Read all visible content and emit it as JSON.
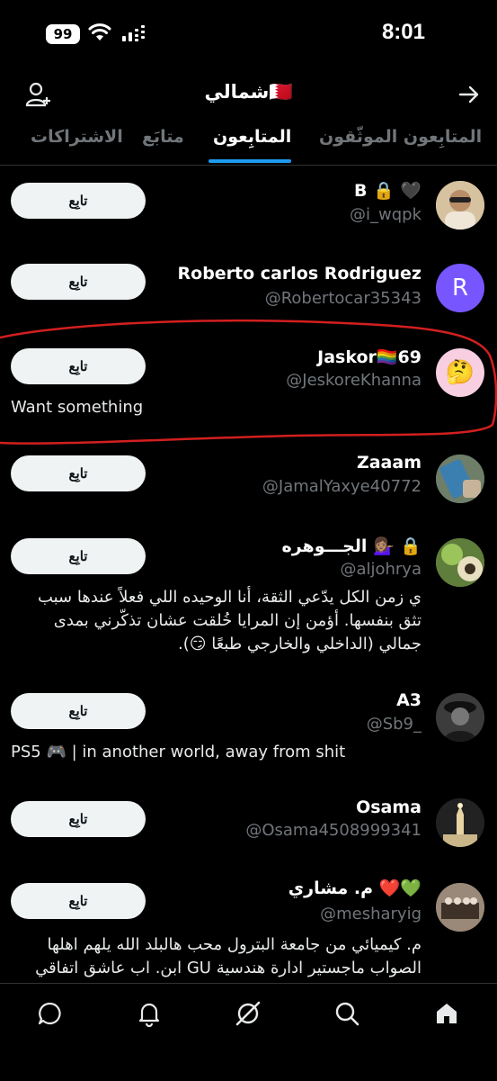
{
  "status": {
    "time": "8:01",
    "battery": "99"
  },
  "header": {
    "title": "شمالي🇧🇭"
  },
  "tabs": [
    "المتابِعون الموثّقون",
    "المتابِعون",
    "متابَع",
    "الاشتراكات"
  ],
  "follow_label": "تابِع",
  "users": [
    {
      "name": "B 🔒 🖤",
      "handle": "@i_wqpk",
      "bio": ""
    },
    {
      "name": "Roberto carlos Rodriguez",
      "handle": "@Robertocar35343",
      "avatar_letter": "R",
      "bio": ""
    },
    {
      "name": "Jaskor🏳️‍🌈69",
      "handle": "@JeskoreKhanna",
      "avatar_emoji": "🤔",
      "bio": "Want something"
    },
    {
      "name": "Zaaam",
      "handle": "@JamalYaxye40772",
      "bio": ""
    },
    {
      "name": "الجـــوهره 💁🏽‍♀️ 🔒",
      "handle": "@aljohrya",
      "bio": "ي زمن الكل يدّعي الثقة، أنا الوحيده اللي فعلاً عندها سبب تثق بنفسها. أؤمن إن المرايا خُلقت عشان تذكّرني بمدى جمالي (الداخلي والخارجي طبعًا 😏)."
    },
    {
      "name": "A3",
      "handle": "@Sb9_",
      "bio": "PS5 🎮 | in another world, away from shit"
    },
    {
      "name": "Osama",
      "handle": "@Osama4508999341",
      "bio": ""
    },
    {
      "name": "م. مشاري ❤️💚",
      "handle": "@mesharyig",
      "bio": "م. كيميائي من جامعة البترول محب هالبلد الله يلهم اهلها الصواب ماجستير ادارة هندسية GU ابن. اب عاشق اتفاقي"
    }
  ],
  "colors": {
    "accent": "#1d9bf0",
    "annotation": "#d21f1f",
    "avatar_r": "#7856ff",
    "avatar_pink": "#f7cfe0"
  },
  "bottom_nav": [
    "home-icon",
    "search-icon",
    "grok-icon",
    "notifications-icon",
    "messages-icon"
  ]
}
